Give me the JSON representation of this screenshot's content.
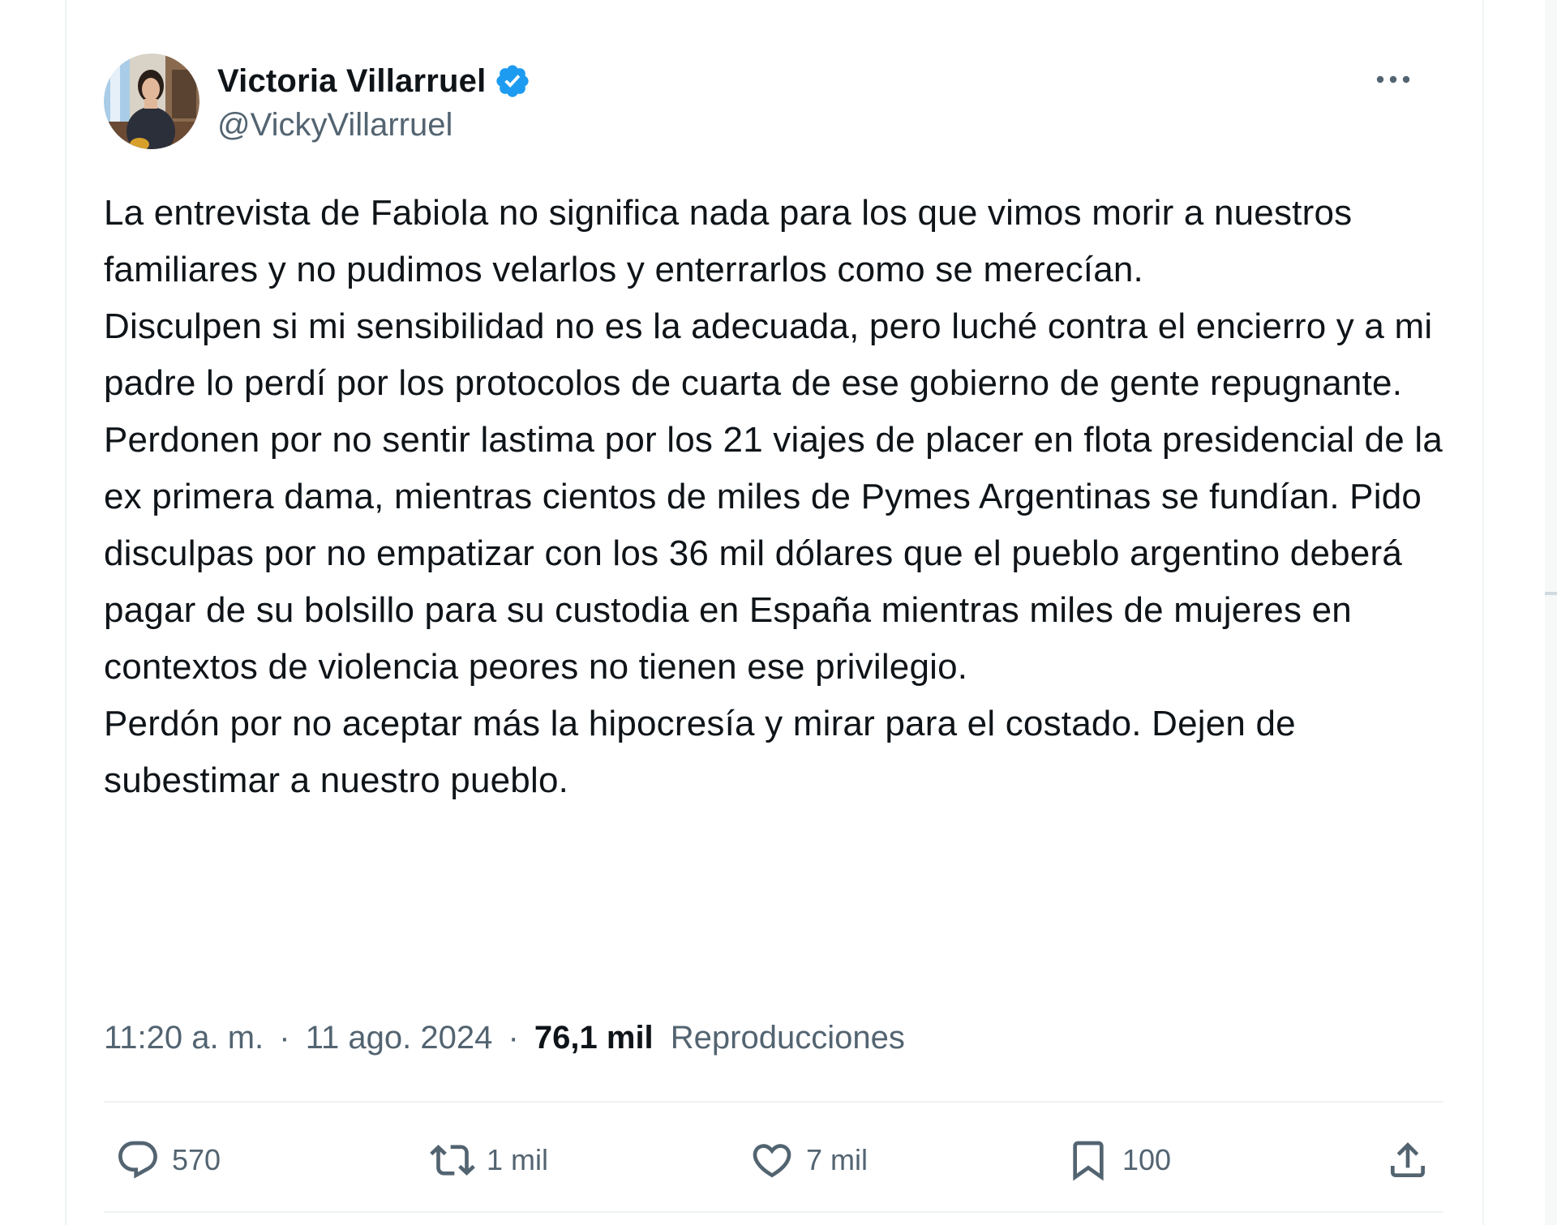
{
  "tweet": {
    "author": {
      "display_name": "Victoria Villarruel",
      "handle": "@VickyVillarruel",
      "verified": true
    },
    "paragraphs": [
      "La entrevista de Fabiola no significa nada para los que vimos morir a nuestros familiares y no pudimos velarlos y enterrarlos como se merecían.",
      "Disculpen si mi sensibilidad no es la adecuada, pero luché contra el encierro y a mi padre lo perdí por los protocolos de cuarta de ese gobierno de gente repugnante.",
      "Perdonen por no sentir lastima por los 21 viajes de placer en flota presidencial de la ex primera dama, mientras cientos de miles de Pymes Argentinas se fundían. Pido disculpas por no empatizar con los 36 mil dólares que el pueblo argentino deberá pagar de su bolsillo para su custodia en España mientras miles de mujeres en contextos de violencia peores no tienen ese privilegio.",
      "Perdón por no aceptar más la hipocresía y mirar para el costado. Dejen de subestimar a nuestro pueblo."
    ],
    "meta": {
      "time": "11:20 a. m.",
      "separator": "·",
      "date": "11 ago. 2024",
      "views_count": "76,1 mil",
      "views_label": "Reproducciones"
    },
    "actions": {
      "replies": "570",
      "reposts": "1 mil",
      "likes": "7 mil",
      "bookmarks": "100"
    }
  },
  "colors": {
    "text_primary": "#0f1419",
    "text_secondary": "#536471",
    "verified_blue": "#1d9bf0",
    "divider": "#eff3f4"
  },
  "icons": {
    "more": "more-horizontal-icon",
    "verified": "verified-badge-icon",
    "reply": "reply-icon",
    "repost": "repost-icon",
    "like": "heart-icon",
    "bookmark": "bookmark-icon",
    "share": "share-icon"
  }
}
